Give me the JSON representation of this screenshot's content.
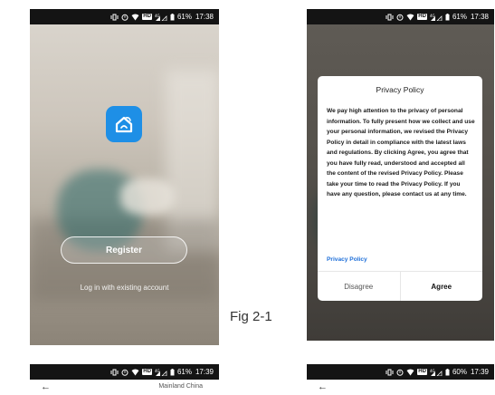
{
  "phones": {
    "p1": {
      "status": {
        "battery": "61%",
        "time": "17:38",
        "hd": "HD"
      }
    },
    "p2": {
      "status": {
        "battery": "61%",
        "time": "17:38",
        "hd": "HD"
      }
    },
    "p3": {
      "status": {
        "battery": "61%",
        "time": "17:39",
        "hd": "HD"
      }
    },
    "p4": {
      "status": {
        "battery": "60%",
        "time": "17:39",
        "hd": "HD"
      }
    }
  },
  "welcome": {
    "register_label": "Register",
    "login_label": "Log in with existing account"
  },
  "figure_label": "Fig 2-1",
  "privacy_dialog": {
    "title": "Privacy Policy",
    "body": "We pay high attention to the privacy of personal information. To fully present how we collect and use your personal information, we revised the Privacy Policy in detail in compliance with the latest laws and regulations. By clicking Agree, you agree that you have fully read, understood and accepted all the content of the revised Privacy Policy. Please take your time to read the Privacy Policy. If you have any question, please contact us at any time.",
    "link": "Privacy Policy",
    "disagree_label": "Disagree",
    "agree_label": "Agree"
  },
  "nav": {
    "back_icon": "back-arrow-icon",
    "region_label": "Mainland China"
  },
  "colors": {
    "app_icon": "#1e8fe6",
    "link": "#1e6fd9",
    "statusbar": "#141414"
  }
}
